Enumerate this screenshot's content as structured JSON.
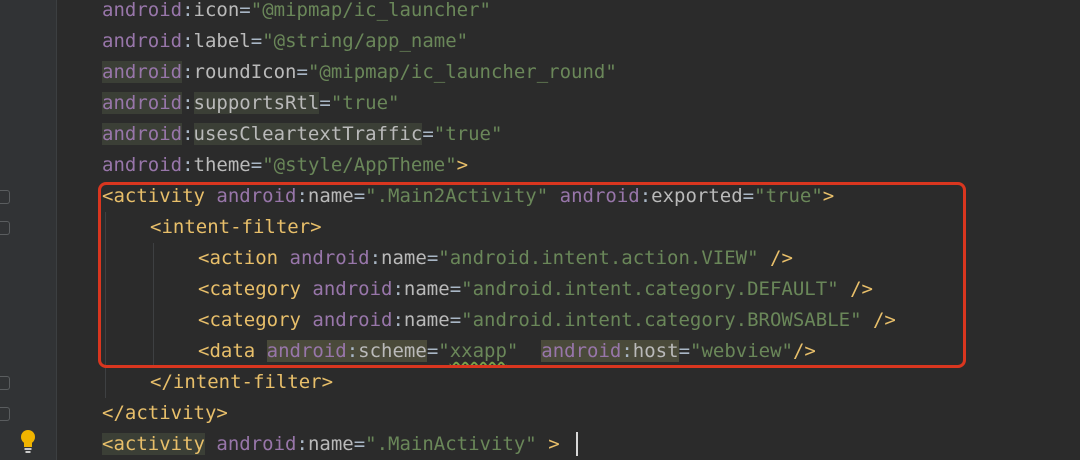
{
  "editor": {
    "lines": [
      {
        "indent": 0,
        "tokens": [
          {
            "t": "ns",
            "v": "android"
          },
          {
            "t": "eq",
            "v": ":"
          },
          {
            "t": "attr",
            "v": "icon"
          },
          {
            "t": "eq",
            "v": "="
          },
          {
            "t": "str",
            "v": "\"@mipmap/ic_launcher\""
          }
        ]
      },
      {
        "indent": 0,
        "tokens": [
          {
            "t": "ns",
            "v": "android"
          },
          {
            "t": "eq",
            "v": ":"
          },
          {
            "t": "attr",
            "v": "label"
          },
          {
            "t": "eq",
            "v": "="
          },
          {
            "t": "str",
            "v": "\"@string/app_name\""
          }
        ]
      },
      {
        "indent": 0,
        "tokens": [
          {
            "t": "ns hl",
            "v": "android"
          },
          {
            "t": "eq",
            "v": ":"
          },
          {
            "t": "attr",
            "v": "roundIcon"
          },
          {
            "t": "eq",
            "v": "="
          },
          {
            "t": "str",
            "v": "\"@mipmap/ic_launcher_round\""
          }
        ]
      },
      {
        "indent": 0,
        "tokens": [
          {
            "t": "ns hl",
            "v": "android"
          },
          {
            "t": "eq",
            "v": ":"
          },
          {
            "t": "attr hl",
            "v": "supportsRtl"
          },
          {
            "t": "eq",
            "v": "="
          },
          {
            "t": "str",
            "v": "\"true\""
          }
        ]
      },
      {
        "indent": 0,
        "tokens": [
          {
            "t": "ns hl",
            "v": "android"
          },
          {
            "t": "eq",
            "v": ":"
          },
          {
            "t": "attr hl",
            "v": "usesCleartextTraffic"
          },
          {
            "t": "eq",
            "v": "="
          },
          {
            "t": "str",
            "v": "\"true\""
          }
        ]
      },
      {
        "indent": 0,
        "tokens": [
          {
            "t": "ns",
            "v": "android"
          },
          {
            "t": "eq",
            "v": ":"
          },
          {
            "t": "attr",
            "v": "theme"
          },
          {
            "t": "eq",
            "v": "="
          },
          {
            "t": "str",
            "v": "\"@style/AppTheme\""
          },
          {
            "t": "tag",
            "v": ">"
          }
        ]
      },
      {
        "indent": 0,
        "tokens": [
          {
            "t": "tag",
            "v": "<activity "
          },
          {
            "t": "ns",
            "v": "android"
          },
          {
            "t": "eq",
            "v": ":"
          },
          {
            "t": "attr",
            "v": "name"
          },
          {
            "t": "eq",
            "v": "="
          },
          {
            "t": "str",
            "v": "\".Main2Activity\""
          },
          {
            "t": "eq",
            "v": " "
          },
          {
            "t": "ns",
            "v": "android"
          },
          {
            "t": "eq",
            "v": ":"
          },
          {
            "t": "attr",
            "v": "exported"
          },
          {
            "t": "eq",
            "v": "="
          },
          {
            "t": "str",
            "v": "\"true\""
          },
          {
            "t": "tag",
            "v": ">"
          }
        ]
      },
      {
        "indent": 2,
        "tokens": [
          {
            "t": "tag",
            "v": "<intent-filter>"
          }
        ]
      },
      {
        "indent": 4,
        "tokens": [
          {
            "t": "tag",
            "v": "<action "
          },
          {
            "t": "ns",
            "v": "android"
          },
          {
            "t": "eq",
            "v": ":"
          },
          {
            "t": "attr",
            "v": "name"
          },
          {
            "t": "eq",
            "v": "="
          },
          {
            "t": "str",
            "v": "\"android.intent.action.VIEW\""
          },
          {
            "t": "eq",
            "v": " "
          },
          {
            "t": "tag",
            "v": "/>"
          }
        ]
      },
      {
        "indent": 4,
        "tokens": [
          {
            "t": "tag",
            "v": "<category "
          },
          {
            "t": "ns",
            "v": "android"
          },
          {
            "t": "eq",
            "v": ":"
          },
          {
            "t": "attr",
            "v": "name"
          },
          {
            "t": "eq",
            "v": "="
          },
          {
            "t": "str",
            "v": "\"android.intent.category.DEFAULT\""
          },
          {
            "t": "eq",
            "v": " "
          },
          {
            "t": "tag",
            "v": "/>"
          }
        ]
      },
      {
        "indent": 4,
        "tokens": [
          {
            "t": "tag",
            "v": "<category "
          },
          {
            "t": "ns",
            "v": "android"
          },
          {
            "t": "eq",
            "v": ":"
          },
          {
            "t": "attr",
            "v": "name"
          },
          {
            "t": "eq",
            "v": "="
          },
          {
            "t": "str",
            "v": "\"android.intent.category.BROWSABLE\""
          },
          {
            "t": "eq",
            "v": " "
          },
          {
            "t": "tag",
            "v": "/>"
          }
        ]
      },
      {
        "indent": 4,
        "tokens": [
          {
            "t": "tag",
            "v": "<data "
          },
          {
            "t": "ns hl-strong",
            "v": "android"
          },
          {
            "t": "eq hl-strong",
            "v": ":"
          },
          {
            "t": "attr hl-strong",
            "v": "scheme"
          },
          {
            "t": "eq",
            "v": "="
          },
          {
            "t": "str",
            "v": "\""
          },
          {
            "t": "str squiggle",
            "v": "xxapp"
          },
          {
            "t": "str",
            "v": "\""
          },
          {
            "t": "eq",
            "v": "  "
          },
          {
            "t": "ns hl-strong",
            "v": "android"
          },
          {
            "t": "eq hl-strong",
            "v": ":"
          },
          {
            "t": "attr hl-strong",
            "v": "host"
          },
          {
            "t": "eq",
            "v": "="
          },
          {
            "t": "str",
            "v": "\"webview\""
          },
          {
            "t": "tag",
            "v": "/>"
          }
        ]
      },
      {
        "indent": 2,
        "tokens": [
          {
            "t": "tag",
            "v": "</intent-filter>"
          }
        ]
      },
      {
        "indent": 0,
        "tokens": [
          {
            "t": "tag",
            "v": "</activity>"
          }
        ]
      },
      {
        "indent": 0,
        "tokens": [
          {
            "t": "tag hl",
            "v": "<activity"
          },
          {
            "t": "eq",
            "v": " "
          },
          {
            "t": "ns",
            "v": "android"
          },
          {
            "t": "eq",
            "v": ":"
          },
          {
            "t": "attr",
            "v": "name"
          },
          {
            "t": "eq",
            "v": "="
          },
          {
            "t": "str",
            "v": "\".MainActivity\""
          },
          {
            "t": "eq",
            "v": " "
          },
          {
            "t": "tag",
            "v": ">"
          }
        ]
      }
    ]
  },
  "colors": {
    "background": "#2b2b2b",
    "gutter": "#313335",
    "highlight_box": "#d9361f",
    "tag": "#e8bf6a",
    "namespace": "#9876aa",
    "string": "#6a8759"
  },
  "icons": {
    "gutter_bulb": "lightbulb-icon",
    "fold": "fold-marker-icon"
  }
}
